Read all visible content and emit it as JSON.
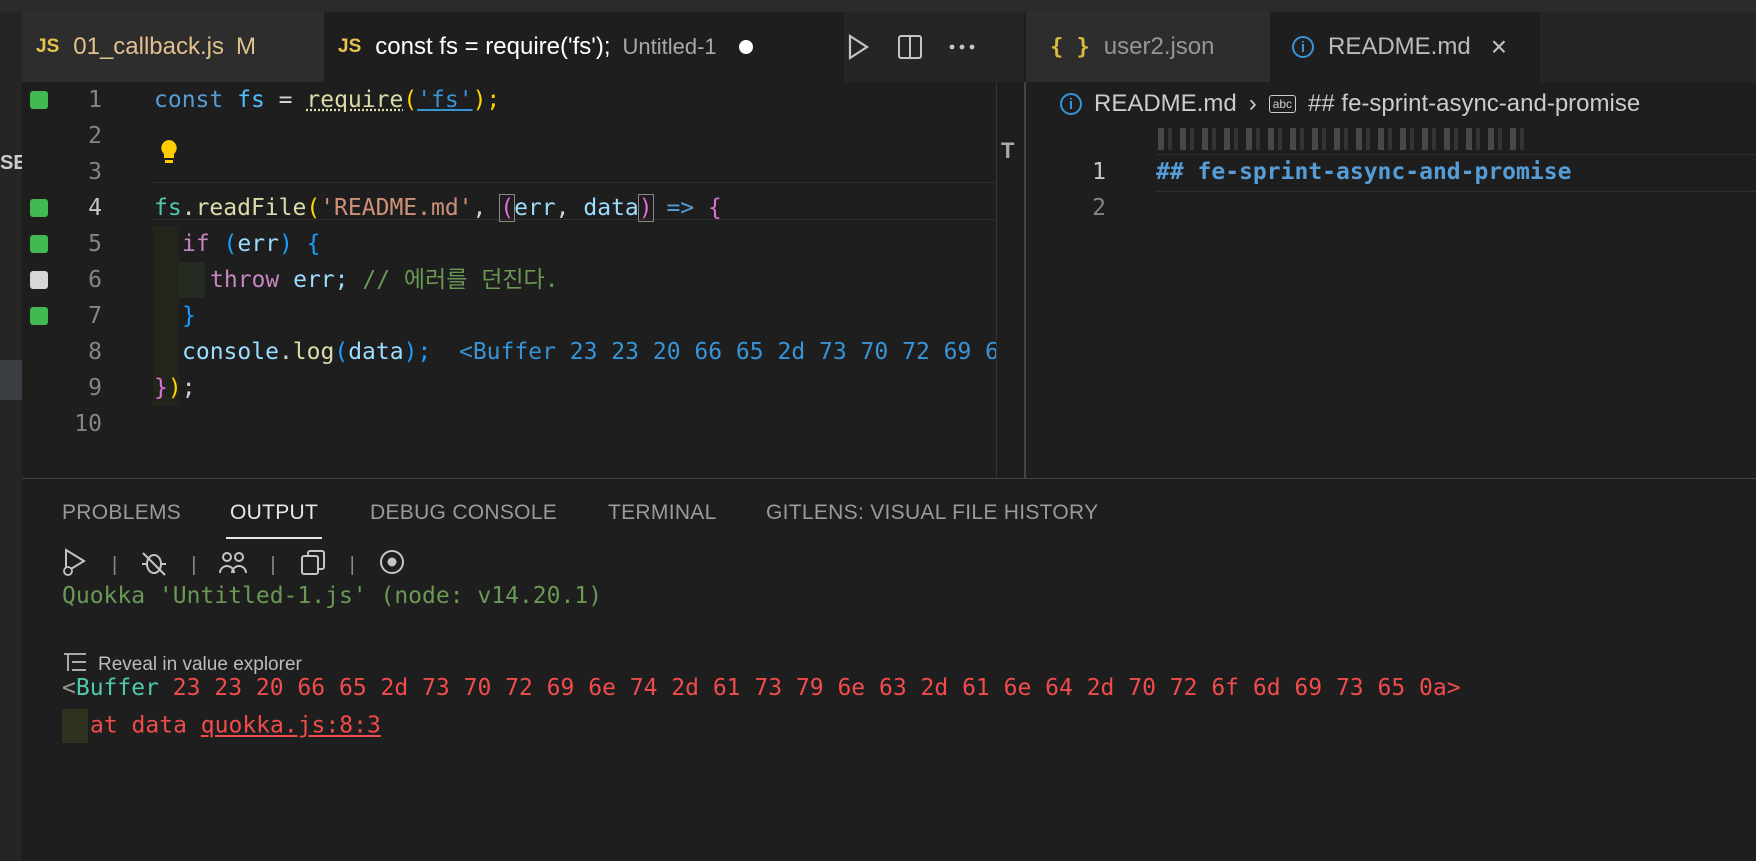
{
  "tabs": [
    {
      "lang": "JS",
      "name": "01_callback.js",
      "status": "M"
    },
    {
      "lang": "JS",
      "name": "const fs = require('fs');",
      "subtitle": "Untitled-1"
    },
    {
      "icon": "{ }",
      "name": "user2.json"
    },
    {
      "name": "README.md"
    }
  ],
  "editor_left": {
    "line_numbers": [
      "1",
      "2",
      "3",
      "4",
      "5",
      "6",
      "7",
      "8",
      "9",
      "10"
    ],
    "l1": {
      "a": "const",
      "b": "fs",
      "c": "=",
      "d": "require",
      "e": "(",
      "f": "'fs'",
      "g": ");"
    },
    "l4": {
      "a": "fs",
      "b": ".",
      "c": "readFile",
      "d": "(",
      "e": "'README.md'",
      "f": ", ",
      "g": "(",
      "h": "err",
      "i": ", ",
      "j": "data",
      "k": ")",
      "l": " => ",
      "m": "{"
    },
    "l5": {
      "a": "if",
      "b": " (",
      "c": "err",
      "d": ") ",
      "e": "{"
    },
    "l6": {
      "a": "throw",
      "b": " err;",
      "c": " // 에러를 던진다."
    },
    "l7": {
      "a": "}"
    },
    "l8": {
      "a": "console",
      "b": ".",
      "c": "log",
      "d": "(",
      "e": "data",
      "f": ");",
      "g": "  <Buffer 23 23 20 66 65 2d 73 70 72 69 6"
    },
    "l9": {
      "a": "}",
      "b": ")",
      "c": ";"
    }
  },
  "editor_right": {
    "breadcrumb_file": "README.md",
    "breadcrumb_abc": "abc",
    "breadcrumb_heading": "## fe-sprint-async-and-promise",
    "line_numbers": [
      "1",
      "2"
    ],
    "l1": "## fe-sprint-async-and-promise"
  },
  "panel": {
    "tabs": [
      "PROBLEMS",
      "OUTPUT",
      "DEBUG CONSOLE",
      "TERMINAL",
      "GITLENS: VISUAL FILE HISTORY"
    ],
    "quokka_line": "Quokka 'Untitled-1.js' (node: v14.20.1)",
    "reveal_label": "Reveal in value explorer",
    "buffer_open": "<",
    "buffer_word": "Buffer",
    "buffer_bytes": " 23 23 20 66 65 2d 73 70 72 69 6e 74 2d 61 73 79 6e 63 2d 61 6e 64 2d 70 72 6f 6d 69 73 65 0a",
    "buffer_close": ">",
    "at_data": "at data ",
    "location": "quokka.js:8:3"
  },
  "left_gutter_glyph": "SE",
  "colors": {
    "accent": "#3794d6",
    "added": "#3fb950",
    "error": "#f14c4c",
    "quokka": "#6a9955"
  }
}
